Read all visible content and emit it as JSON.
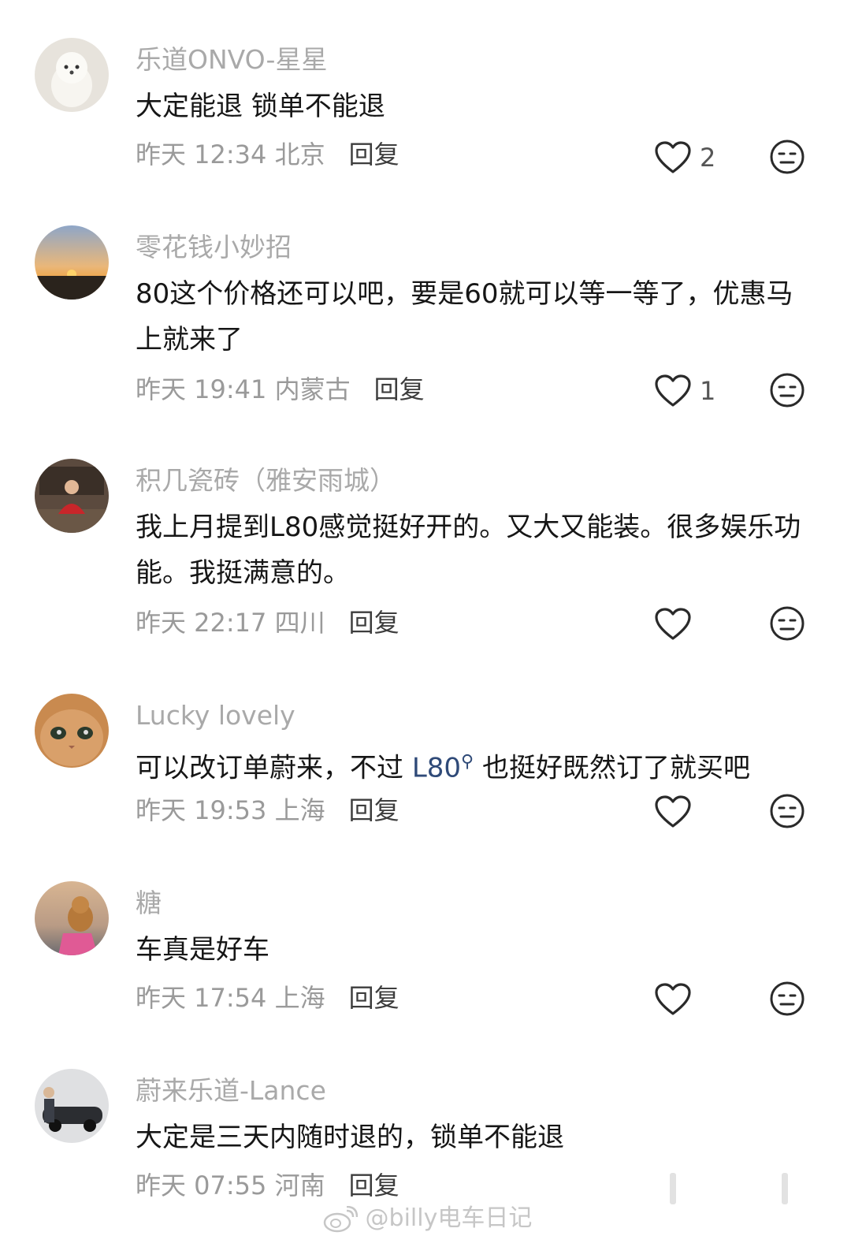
{
  "comments": [
    {
      "username": "乐道ONVO-星星",
      "text": "大定能退 锁单不能退",
      "meta": "昨天 12:34 北京",
      "reply": "回复",
      "likes": "2"
    },
    {
      "username": "零花钱小妙招",
      "text": "80这个价格还可以吧，要是60就可以等一等了，优惠马上就来了",
      "meta": "昨天 19:41 内蒙古",
      "reply": "回复",
      "likes": "1"
    },
    {
      "username": "积几瓷砖（雅安雨城）",
      "text": "我上月提到L80感觉挺好开的。又大又能装。很多娱乐功能。我挺满意的。",
      "meta": "昨天 22:17 四川",
      "reply": "回复",
      "likes": ""
    },
    {
      "username": "Lucky lovely",
      "text_before": "可以改订单蔚来，不过 ",
      "mention": "L80",
      "text_after": " 也挺好既然订了就买吧",
      "meta": "昨天 19:53 上海",
      "reply": "回复",
      "likes": ""
    },
    {
      "username": "糖",
      "text": "车真是好车",
      "meta": "昨天 17:54 上海",
      "reply": "回复",
      "likes": ""
    },
    {
      "username": "蔚来乐道-Lance",
      "text": "大定是三天内随时退的，锁单不能退",
      "meta": "昨天 07:55 河南",
      "reply": "回复",
      "likes": ""
    }
  ],
  "watermark": "@billy电车日记",
  "icons": {
    "like": "heart-outline-icon",
    "dislike": "meh-face-icon",
    "search": "search-icon"
  }
}
